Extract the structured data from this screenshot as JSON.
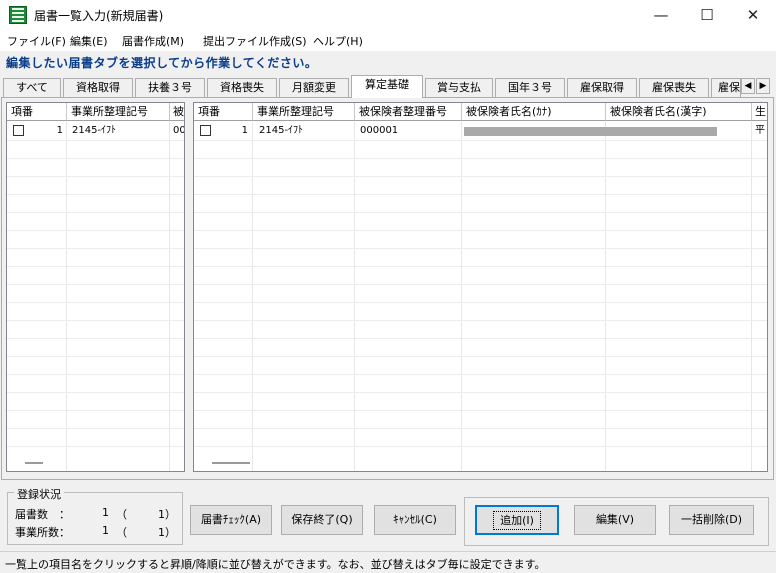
{
  "window": {
    "title": "届書一覧入力(新規届書)",
    "minimize": "—",
    "maximize": "☐",
    "close": "✕"
  },
  "menu": {
    "items": [
      {
        "label": "ファイル(F)"
      },
      {
        "label": "編集(E)"
      },
      {
        "label": "届書作成(M)"
      },
      {
        "label": "提出ファイル作成(S)"
      },
      {
        "label": "ヘルプ(H)"
      }
    ]
  },
  "instruction": "編集したい届書タブを選択してから作業してください。",
  "tabs": [
    {
      "label": "すべて"
    },
    {
      "label": "資格取得"
    },
    {
      "label": "扶養３号"
    },
    {
      "label": "資格喪失"
    },
    {
      "label": "月額変更"
    },
    {
      "label": "算定基礎",
      "active": true
    },
    {
      "label": "賞与支払"
    },
    {
      "label": "国年３号"
    },
    {
      "label": "雇保取得"
    },
    {
      "label": "雇保喪失"
    },
    {
      "label": "雇保"
    }
  ],
  "tab_scroll": {
    "left": "◀",
    "right": "▶"
  },
  "left_grid": {
    "columns": [
      "項番",
      "事業所整理記号",
      "被"
    ],
    "rows": [
      {
        "checked": false,
        "no": "1",
        "office_code": "2145-ｲﾌﾄ",
        "insured": "00"
      }
    ]
  },
  "right_grid": {
    "columns": [
      "項番",
      "事業所整理記号",
      "被保険者整理番号",
      "被保険者氏名(ｶﾅ)",
      "被保険者氏名(漢字)",
      "生"
    ],
    "rows": [
      {
        "checked": false,
        "no": "1",
        "office_code": "2145-ｲﾌﾄ",
        "insured_no": "000001",
        "name_kana": "",
        "name_kanji": "",
        "birth": "平"
      }
    ]
  },
  "registration": {
    "title": "登録状況",
    "count_label": "届書数　：",
    "count_a": "1",
    "count_b": "1）",
    "office_label": "事業所数：",
    "office_a": "1",
    "office_b": "1）",
    "paren": "（"
  },
  "buttons": {
    "check": "届書ﾁｪｯｸ(A)",
    "save_exit": "保存終了(Q)",
    "cancel": "ｷｬﾝｾﾙ(C)",
    "add": "追加(I)",
    "edit": "編集(V)",
    "bulk_delete": "一括削除(D)"
  },
  "status": "一覧上の項目名をクリックすると昇順/降順に並び替えができます。なお、並び替えはタブ毎に設定できます。",
  "colors": {
    "instruction": "#0b3d8a",
    "app_icon": "#1f8a3a",
    "default_button_border": "#0078d7"
  }
}
